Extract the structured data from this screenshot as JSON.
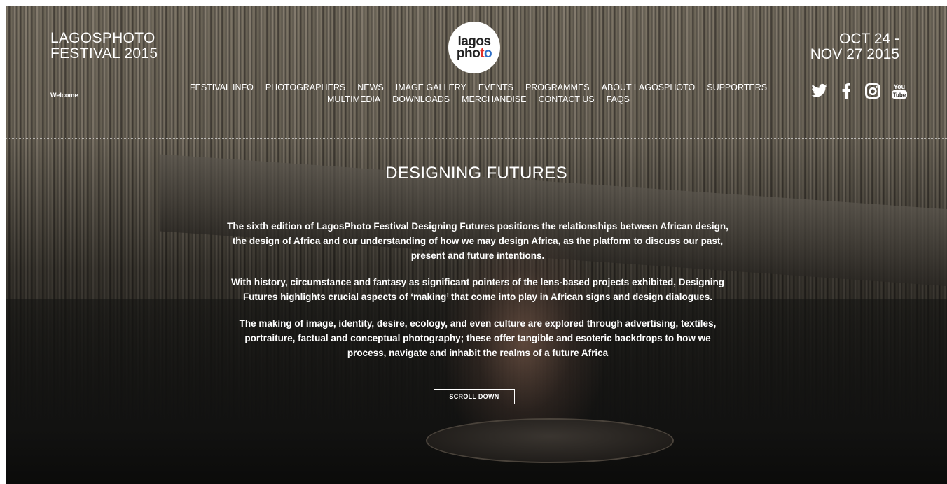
{
  "brand": {
    "title_line1": "LAGOSPHOTO",
    "title_line2": "FESTIVAL 2015",
    "welcome": "Welcome",
    "logo_line1": "lagos",
    "logo_line2": "photo"
  },
  "dates": {
    "line1": "OCT 24 -",
    "line2": "NOV 27 2015"
  },
  "nav": {
    "row1": [
      "FESTIVAL INFO",
      "PHOTOGRAPHERS",
      "NEWS",
      "IMAGE GALLERY",
      "EVENTS",
      "PROGRAMMES",
      "ABOUT LAGOSPHOTO",
      "SUPPORTERS"
    ],
    "row2": [
      "MULTIMEDIA",
      "DOWNLOADS",
      "MERCHANDISE",
      "CONTACT US",
      "FAQS"
    ]
  },
  "social": {
    "icons": [
      "twitter-icon",
      "facebook-icon",
      "instagram-icon",
      "youtube-icon"
    ],
    "youtube_top": "You",
    "youtube_bottom": "Tube"
  },
  "hero": {
    "headline": "DESIGNING FUTURES",
    "paragraphs": [
      "The sixth edition of LagosPhoto Festival Designing Futures positions the relationships between African design, the design of Africa and our understanding of how we may design Africa, as the platform to discuss our past, present and future intentions.",
      "With history, circumstance and fantasy as significant pointers of the lens-based projects exhibited, Designing Futures highlights crucial aspects of ‘making’ that come into play in African signs and design dialogues.",
      "The making of image, identity, desire, ecology, and even culture are explored through advertising, textiles, portraiture, factual and conceptual photography; these offer tangible and esoteric backdrops to how we process, navigate and inhabit the realms of a future Africa"
    ],
    "scroll_label": "SCROLL DOWN"
  },
  "colors": {
    "text": "#ffffff",
    "logo_bg": "#ffffff",
    "logo_red": "#e0312b",
    "logo_blue": "#2e6fc7",
    "logo_yellow": "#f2c12e"
  }
}
